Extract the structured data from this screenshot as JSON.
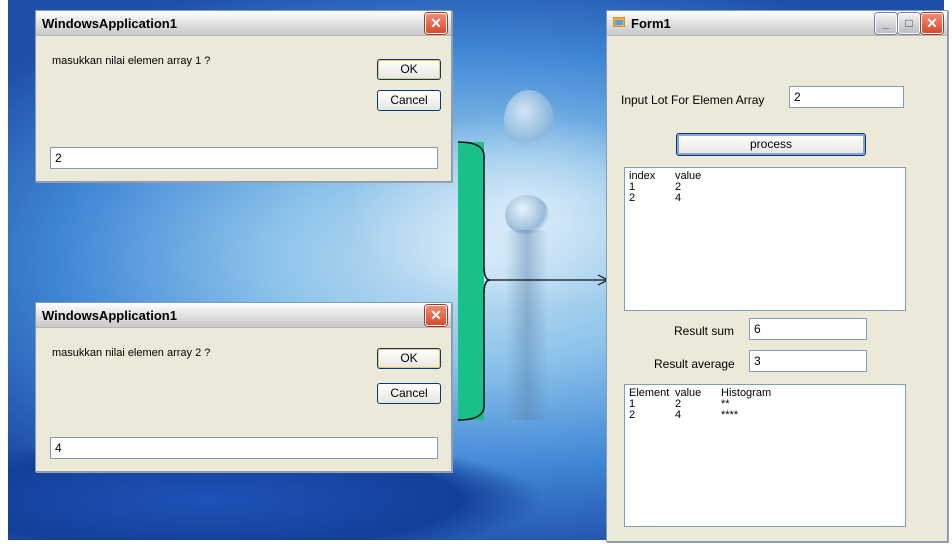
{
  "dialog1": {
    "title": "WindowsApplication1",
    "prompt": "masukkan nilai elemen array 1 ?",
    "ok_label": "OK",
    "cancel_label": "Cancel",
    "input_value": "2"
  },
  "dialog2": {
    "title": "WindowsApplication1",
    "prompt": "masukkan nilai elemen array 2 ?",
    "ok_label": "OK",
    "cancel_label": "Cancel",
    "input_value": "4"
  },
  "form1": {
    "title": "Form1",
    "input_label": "Input Lot For Elemen Array",
    "input_value": "2",
    "process_label": "process",
    "list1": {
      "headers": [
        "index",
        "value"
      ],
      "rows": [
        [
          "1",
          "2"
        ],
        [
          "2",
          "4"
        ]
      ]
    },
    "result_sum_label": "Result sum",
    "result_sum_value": "6",
    "result_avg_label": "Result average",
    "result_avg_value": "3",
    "list2": {
      "headers": [
        "Element",
        "value",
        "Histogram"
      ],
      "rows": [
        [
          "1",
          "2",
          "**"
        ],
        [
          "2",
          "4",
          "****"
        ]
      ]
    }
  },
  "colors": {
    "connector": "#19c08a",
    "close_button": "#d54b2e"
  }
}
